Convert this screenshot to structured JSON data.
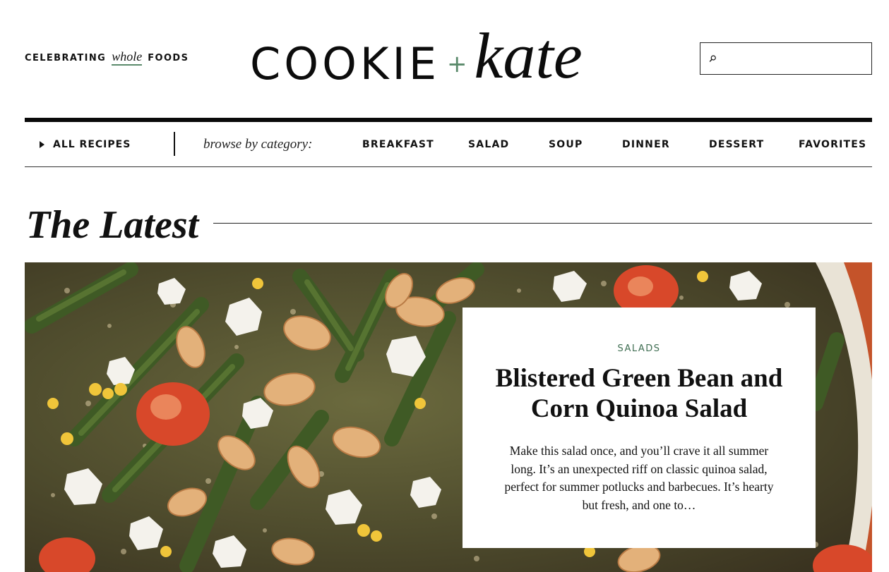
{
  "header": {
    "tagline_before": "CELEBRATING",
    "tagline_italic": "whole",
    "tagline_after": "FOODS",
    "logo_primary": "COOKIE",
    "logo_plus": "+",
    "logo_secondary": "kate",
    "search": {
      "value": "",
      "placeholder": "",
      "icon": "search-icon"
    }
  },
  "nav": {
    "all_recipes": "ALL RECIPES",
    "browse_label": "browse by category:",
    "categories": [
      "BREAKFAST",
      "SALAD",
      "SOUP",
      "DINNER",
      "DESSERT",
      "FAVORITES"
    ]
  },
  "section": {
    "title": "The Latest"
  },
  "featured": {
    "category": "SALADS",
    "title": "Blistered Green Bean and Corn Quinoa Salad",
    "excerpt": "Make this salad once, and you’ll crave it all summer long. It’s an unexpected riff on classic quinoa salad, perfect for summer potlucks and barbecues. It’s hearty but fresh, and one to…"
  },
  "colors": {
    "accent_green": "#5a8a6b",
    "category_green": "#3f6e52",
    "text": "#111111",
    "rule": "#0a0a0a"
  }
}
